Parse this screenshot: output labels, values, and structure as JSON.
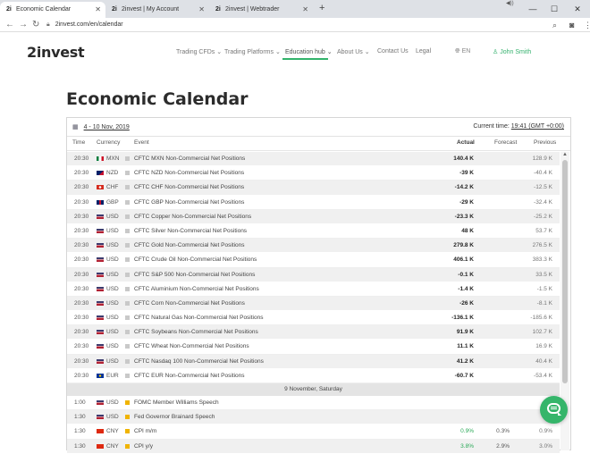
{
  "browser": {
    "tabs": [
      {
        "favicon": "2i",
        "title": "Economic Calendar"
      },
      {
        "favicon": "2i",
        "title": "2invest | My Account"
      },
      {
        "favicon": "2i",
        "title": "2invest | Webtrader"
      }
    ],
    "url": "2invest.com/en/calendar",
    "icons": {
      "back": "back-arrow-icon",
      "forward": "forward-arrow-icon",
      "reload": "reload-icon",
      "lock": "lock-icon",
      "zoom": "zoom-icon",
      "profile": "profile-icon",
      "menu": "kebab-menu-icon"
    }
  },
  "site": {
    "logo": "2invest",
    "nav": [
      "Trading CFDs",
      "Trading Platforms",
      "Education hub",
      "About Us",
      "Contact Us",
      "Legal"
    ],
    "active_nav": "Education hub",
    "lang": "EN",
    "user": "John Smith",
    "accent": "#35b16e"
  },
  "page": {
    "title": "Economic Calendar"
  },
  "calendar": {
    "range": "4 - 10 Nov, 2019",
    "current_time_label": "Current time:",
    "current_time_value": "19:41 (GMT +0:00)",
    "columns": {
      "time": "Time",
      "currency": "Currency",
      "event": "Event",
      "actual": "Actual",
      "forecast": "Forecast",
      "previous": "Previous"
    },
    "rows": [
      {
        "time": "20:30",
        "flag": "mx",
        "currency": "MXN",
        "event": "CFTC MXN Non-Commercial Net Positions",
        "actual": "140.4 K",
        "forecast": "",
        "previous": "128.9 K"
      },
      {
        "time": "20:30",
        "flag": "nz",
        "currency": "NZD",
        "event": "CFTC NZD Non-Commercial Net Positions",
        "actual": "-39 K",
        "forecast": "",
        "previous": "-40.4 K"
      },
      {
        "time": "20:30",
        "flag": "ch",
        "currency": "CHF",
        "event": "CFTC CHF Non-Commercial Net Positions",
        "actual": "-14.2 K",
        "forecast": "",
        "previous": "-12.5 K"
      },
      {
        "time": "20:30",
        "flag": "gb",
        "currency": "GBP",
        "event": "CFTC GBP Non-Commercial Net Positions",
        "actual": "-29 K",
        "forecast": "",
        "previous": "-32.4 K"
      },
      {
        "time": "20:30",
        "flag": "us",
        "currency": "USD",
        "event": "CFTC Copper Non-Commercial Net Positions",
        "actual": "-23.3 K",
        "forecast": "",
        "previous": "-25.2 K"
      },
      {
        "time": "20:30",
        "flag": "us",
        "currency": "USD",
        "event": "CFTC Silver Non-Commercial Net Positions",
        "actual": "48 K",
        "forecast": "",
        "previous": "53.7 K"
      },
      {
        "time": "20:30",
        "flag": "us",
        "currency": "USD",
        "event": "CFTC Gold Non-Commercial Net Positions",
        "actual": "279.8 K",
        "forecast": "",
        "previous": "276.5 K"
      },
      {
        "time": "20:30",
        "flag": "us",
        "currency": "USD",
        "event": "CFTC Crude Oil Non-Commercial Net Positions",
        "actual": "406.1 K",
        "forecast": "",
        "previous": "383.3 K"
      },
      {
        "time": "20:30",
        "flag": "us",
        "currency": "USD",
        "event": "CFTC S&P 500 Non-Commercial Net Positions",
        "actual": "-0.1 K",
        "forecast": "",
        "previous": "33.5 K"
      },
      {
        "time": "20:30",
        "flag": "us",
        "currency": "USD",
        "event": "CFTC Aluminium Non-Commercial Net Positions",
        "actual": "-1.4 K",
        "forecast": "",
        "previous": "-1.5 K"
      },
      {
        "time": "20:30",
        "flag": "us",
        "currency": "USD",
        "event": "CFTC Corn Non-Commercial Net Positions",
        "actual": "-26 K",
        "forecast": "",
        "previous": "-8.1 K"
      },
      {
        "time": "20:30",
        "flag": "us",
        "currency": "USD",
        "event": "CFTC Natural Gas Non-Commercial Net Positions",
        "actual": "-136.1 K",
        "forecast": "",
        "previous": "-185.6 K"
      },
      {
        "time": "20:30",
        "flag": "us",
        "currency": "USD",
        "event": "CFTC Soybeans Non-Commercial Net Positions",
        "actual": "91.9 K",
        "forecast": "",
        "previous": "102.7 K"
      },
      {
        "time": "20:30",
        "flag": "us",
        "currency": "USD",
        "event": "CFTC Wheat Non-Commercial Net Positions",
        "actual": "11.1 K",
        "forecast": "",
        "previous": "16.9 K"
      },
      {
        "time": "20:30",
        "flag": "us",
        "currency": "USD",
        "event": "CFTC Nasdaq 100 Non-Commercial Net Positions",
        "actual": "41.2 K",
        "forecast": "",
        "previous": "40.4 K"
      },
      {
        "time": "20:30",
        "flag": "eu",
        "currency": "EUR",
        "event": "CFTC EUR Non-Commercial Net Positions",
        "actual": "-60.7 K",
        "forecast": "",
        "previous": "-53.4 K"
      }
    ],
    "day_separator": "9 November, Saturday",
    "rows2": [
      {
        "time": "1:00",
        "flag": "us",
        "currency": "USD",
        "event": "FOMC Member Williams Speech",
        "actual": "",
        "forecast": "",
        "previous": "",
        "importance": "yellow"
      },
      {
        "time": "1:30",
        "flag": "us",
        "currency": "USD",
        "event": "Fed Governor Brainard Speech",
        "actual": "",
        "forecast": "",
        "previous": "",
        "importance": "yellow"
      },
      {
        "time": "1:30",
        "flag": "cn",
        "currency": "CNY",
        "event": "CPI m/m",
        "actual": "0.9%",
        "forecast": "0.3%",
        "previous": "0.9%",
        "importance": "yellow",
        "actual_color": "green"
      },
      {
        "time": "1:30",
        "flag": "cn",
        "currency": "CNY",
        "event": "CPI y/y",
        "actual": "3.8%",
        "forecast": "2.9%",
        "previous": "3.0%",
        "importance": "yellow",
        "actual_color": "green"
      }
    ]
  }
}
